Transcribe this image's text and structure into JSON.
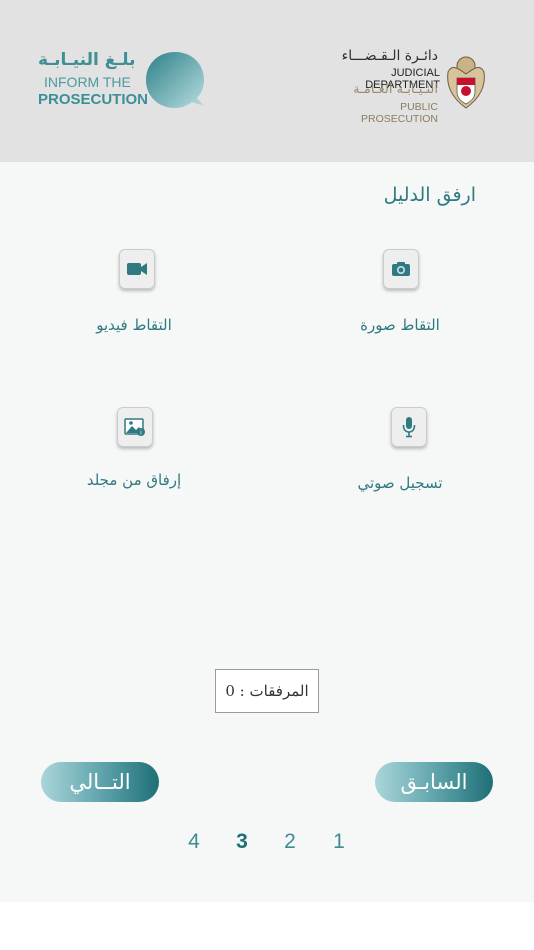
{
  "header": {
    "inform_logo": {
      "arabic": "بلـغ النيـابـة",
      "english_line1": "INFORM THE",
      "english_line2": "PROSECUTION"
    },
    "judicial_logo": {
      "arabic_line1": "دائـرة الـقـضـــاء",
      "english_line1": "JUDICIAL DEPARTMENT",
      "arabic_line2": "النـيـابـة العـامـة",
      "english_line2": "PUBLIC PROSECUTION"
    }
  },
  "main": {
    "title": "ارفق الدليل",
    "options": {
      "photo": {
        "label": "التقاط صورة",
        "icon": "camera-icon"
      },
      "video": {
        "label": "التقاط فيديو",
        "icon": "video-camera-icon"
      },
      "audio": {
        "label": "تسجيل صوتي",
        "icon": "microphone-icon"
      },
      "folder": {
        "label": "إرفاق من مجلد",
        "icon": "image-gallery-icon"
      }
    },
    "attachments_counter": "المرفقات : 0"
  },
  "navigation": {
    "previous_label": "السابـق",
    "next_label": "التــالي"
  },
  "steps": {
    "items": [
      "1",
      "2",
      "3",
      "4"
    ],
    "active": "3"
  },
  "colors": {
    "accent": "#2f7a80",
    "header_bg": "#e2e2e2",
    "main_bg": "#f5f8f7"
  }
}
